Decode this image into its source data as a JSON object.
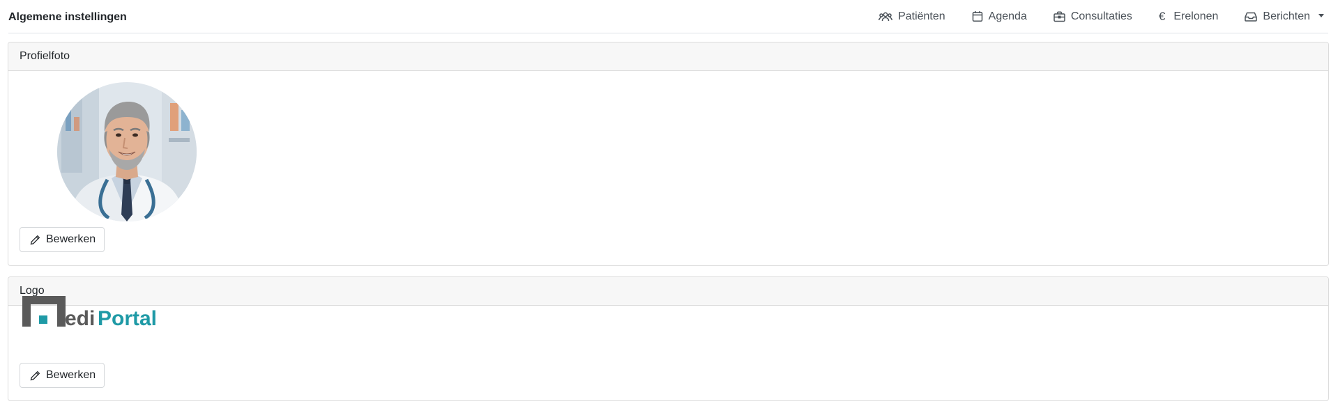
{
  "header": {
    "title": "Algemene instellingen",
    "nav": [
      {
        "label": "Patiënten",
        "icon": "users-icon"
      },
      {
        "label": "Agenda",
        "icon": "calendar-icon"
      },
      {
        "label": "Consultaties",
        "icon": "briefcase-icon"
      },
      {
        "label": "Erelonen",
        "icon": "euro-icon"
      },
      {
        "label": "Berichten",
        "icon": "inbox-icon"
      }
    ]
  },
  "cards": {
    "profile": {
      "title": "Profielfoto",
      "edit_label": "Bewerken"
    },
    "logo": {
      "title": "Logo",
      "edit_label": "Bewerken",
      "logo_text_a": "edi",
      "logo_text_b": "Portal"
    }
  },
  "colors": {
    "logo_gray": "#5a5a5a",
    "logo_teal": "#1f9aa6",
    "border": "#dcdcdc",
    "header_bg": "#f7f7f7"
  }
}
